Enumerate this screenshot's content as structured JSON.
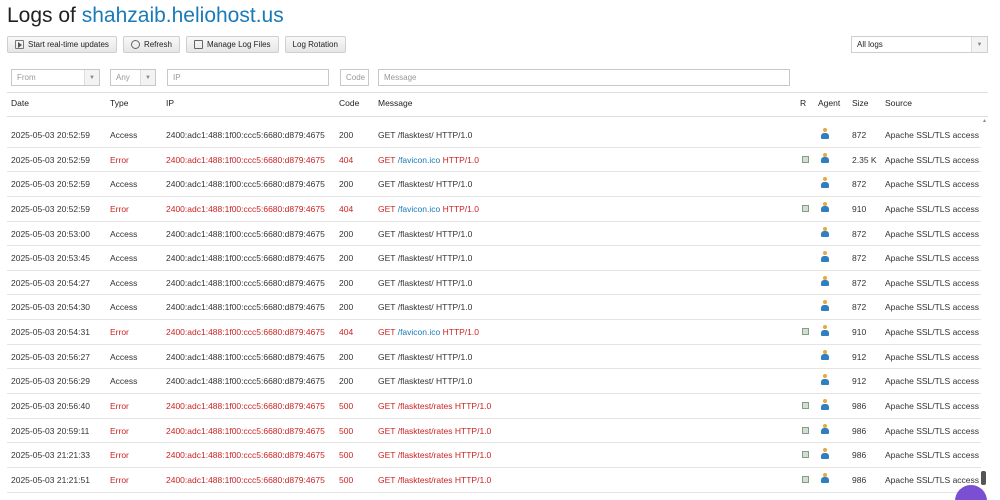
{
  "header": {
    "prefix": "Logs of ",
    "host": "shahzaib.heliohost.us"
  },
  "toolbar": {
    "realtime": "Start real-time updates",
    "refresh": "Refresh",
    "manage": "Manage Log Files",
    "rotation": "Log Rotation"
  },
  "log_select": {
    "value": "All logs"
  },
  "filters": {
    "from": "From",
    "any": "Any",
    "ip": "IP",
    "code": "Code",
    "message": "Message"
  },
  "columns": {
    "date": "Date",
    "type": "Type",
    "ip": "IP",
    "code": "Code",
    "message": "Message",
    "r": "R",
    "agent": "Agent",
    "size": "Size",
    "source": "Source"
  },
  "colors": {
    "accent": "#1a7ab8",
    "error": "#cc2222"
  },
  "rows": [
    {
      "date": "2025-05-03 20:52:59",
      "type": "Access",
      "ip": "2400:adc1:488:1f00:ccc5:6680:d879:4675",
      "code": "200",
      "method": "GET",
      "path": "/flasktest/",
      "proto": "HTTP/1.0",
      "r": false,
      "size": "872",
      "source": "Apache SSL/TLS access",
      "error": false
    },
    {
      "date": "2025-05-03 20:52:59",
      "type": "Error",
      "ip": "2400:adc1:488:1f00:ccc5:6680:d879:4675",
      "code": "404",
      "method": "GET",
      "path": "/favicon.ico",
      "proto": "HTTP/1.0",
      "r": true,
      "size": "2.35 K",
      "source": "Apache SSL/TLS access",
      "error": true,
      "link": true
    },
    {
      "date": "2025-05-03 20:52:59",
      "type": "Access",
      "ip": "2400:adc1:488:1f00:ccc5:6680:d879:4675",
      "code": "200",
      "method": "GET",
      "path": "/flasktest/",
      "proto": "HTTP/1.0",
      "r": false,
      "size": "872",
      "source": "Apache SSL/TLS access",
      "error": false
    },
    {
      "date": "2025-05-03 20:52:59",
      "type": "Error",
      "ip": "2400:adc1:488:1f00:ccc5:6680:d879:4675",
      "code": "404",
      "method": "GET",
      "path": "/favicon.ico",
      "proto": "HTTP/1.0",
      "r": true,
      "size": "910",
      "source": "Apache SSL/TLS access",
      "error": true,
      "link": true
    },
    {
      "date": "2025-05-03 20:53:00",
      "type": "Access",
      "ip": "2400:adc1:488:1f00:ccc5:6680:d879:4675",
      "code": "200",
      "method": "GET",
      "path": "/flasktest/",
      "proto": "HTTP/1.0",
      "r": false,
      "size": "872",
      "source": "Apache SSL/TLS access",
      "error": false
    },
    {
      "date": "2025-05-03 20:53:45",
      "type": "Access",
      "ip": "2400:adc1:488:1f00:ccc5:6680:d879:4675",
      "code": "200",
      "method": "GET",
      "path": "/flasktest/",
      "proto": "HTTP/1.0",
      "r": false,
      "size": "872",
      "source": "Apache SSL/TLS access",
      "error": false
    },
    {
      "date": "2025-05-03 20:54:27",
      "type": "Access",
      "ip": "2400:adc1:488:1f00:ccc5:6680:d879:4675",
      "code": "200",
      "method": "GET",
      "path": "/flasktest/",
      "proto": "HTTP/1.0",
      "r": false,
      "size": "872",
      "source": "Apache SSL/TLS access",
      "error": false
    },
    {
      "date": "2025-05-03 20:54:30",
      "type": "Access",
      "ip": "2400:adc1:488:1f00:ccc5:6680:d879:4675",
      "code": "200",
      "method": "GET",
      "path": "/flasktest/",
      "proto": "HTTP/1.0",
      "r": false,
      "size": "872",
      "source": "Apache SSL/TLS access",
      "error": false
    },
    {
      "date": "2025-05-03 20:54:31",
      "type": "Error",
      "ip": "2400:adc1:488:1f00:ccc5:6680:d879:4675",
      "code": "404",
      "method": "GET",
      "path": "/favicon.ico",
      "proto": "HTTP/1.0",
      "r": true,
      "size": "910",
      "source": "Apache SSL/TLS access",
      "error": true,
      "link": true
    },
    {
      "date": "2025-05-03 20:56:27",
      "type": "Access",
      "ip": "2400:adc1:488:1f00:ccc5:6680:d879:4675",
      "code": "200",
      "method": "GET",
      "path": "/flasktest/",
      "proto": "HTTP/1.0",
      "r": false,
      "size": "912",
      "source": "Apache SSL/TLS access",
      "error": false
    },
    {
      "date": "2025-05-03 20:56:29",
      "type": "Access",
      "ip": "2400:adc1:488:1f00:ccc5:6680:d879:4675",
      "code": "200",
      "method": "GET",
      "path": "/flasktest/",
      "proto": "HTTP/1.0",
      "r": false,
      "size": "912",
      "source": "Apache SSL/TLS access",
      "error": false
    },
    {
      "date": "2025-05-03 20:56:40",
      "type": "Error",
      "ip": "2400:adc1:488:1f00:ccc5:6680:d879:4675",
      "code": "500",
      "method": "GET",
      "path": "/flasktest/rates",
      "proto": "HTTP/1.0",
      "r": true,
      "size": "986",
      "source": "Apache SSL/TLS access",
      "error": true,
      "link": false
    },
    {
      "date": "2025-05-03 20:59:11",
      "type": "Error",
      "ip": "2400:adc1:488:1f00:ccc5:6680:d879:4675",
      "code": "500",
      "method": "GET",
      "path": "/flasktest/rates",
      "proto": "HTTP/1.0",
      "r": true,
      "size": "986",
      "source": "Apache SSL/TLS access",
      "error": true,
      "link": false
    },
    {
      "date": "2025-05-03 21:21:33",
      "type": "Error",
      "ip": "2400:adc1:488:1f00:ccc5:6680:d879:4675",
      "code": "500",
      "method": "GET",
      "path": "/flasktest/rates",
      "proto": "HTTP/1.0",
      "r": true,
      "size": "986",
      "source": "Apache SSL/TLS access",
      "error": true,
      "link": false
    },
    {
      "date": "2025-05-03 21:21:51",
      "type": "Error",
      "ip": "2400:adc1:488:1f00:ccc5:6680:d879:4675",
      "code": "500",
      "method": "GET",
      "path": "/flasktest/rates",
      "proto": "HTTP/1.0",
      "r": true,
      "size": "986",
      "source": "Apache SSL/TLS access",
      "error": true,
      "link": false
    }
  ]
}
